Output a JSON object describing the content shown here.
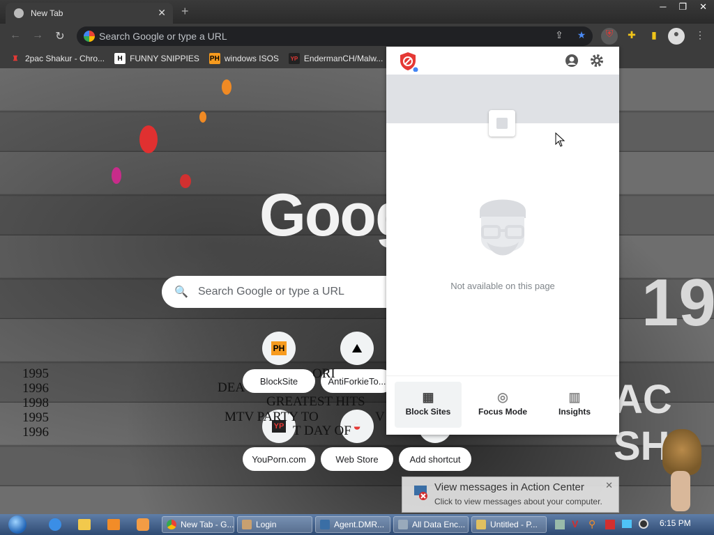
{
  "browser": {
    "tab_title": "New Tab",
    "tab_close": "✕",
    "new_tab": "+",
    "window_controls": [
      "─",
      "❐",
      "✕"
    ],
    "omnibox_placeholder": "Search Google or type a URL"
  },
  "bookmarks": [
    {
      "label": "2pac Shakur - Chro...",
      "icon": "tupac-icon",
      "icon_text": "♜",
      "color": "#e8e8e8"
    },
    {
      "label": "FUNNY SNIPPIES",
      "icon": "h-icon",
      "icon_text": "H",
      "color": "#fff"
    },
    {
      "label": "windows ISOS",
      "icon": "ph-icon",
      "icon_text": "PH",
      "color": "#f79b1e"
    },
    {
      "label": "EndermanCH/Malw...",
      "icon": "yp-icon",
      "icon_text": "YP",
      "color": "#fff"
    }
  ],
  "newtab": {
    "logo": "Goog",
    "search_placeholder": "Search Google or type a URL",
    "shortcuts": [
      {
        "label": "BlockSite",
        "icon_text": "PH"
      },
      {
        "label": "AntiForkieTo...",
        "icon_text": "⛰"
      },
      {
        "label": "YouPorn.com",
        "icon_text": "YP"
      },
      {
        "label": "Web Store",
        "icon_text": "◒"
      },
      {
        "label": "Add shortcut",
        "icon_text": "+"
      }
    ],
    "years": [
      "1995",
      "1996",
      "1998",
      "1995",
      "1996"
    ],
    "song_lines": [
      "ORI",
      "DEA",
      "GREATEST HITS",
      "MTV PARTY TO",
      "V",
      "T DAY OF"
    ],
    "bg_text_right": "AC SH",
    "bg_text_right2": "19"
  },
  "extension_popup": {
    "not_available": "Not available on this page",
    "footer": [
      {
        "label": "Block Sites",
        "icon": "block-sites-icon",
        "glyph": "▦"
      },
      {
        "label": "Focus Mode",
        "icon": "focus-mode-icon",
        "glyph": "◎"
      },
      {
        "label": "Insights",
        "icon": "insights-icon",
        "glyph": "▥"
      }
    ]
  },
  "notification": {
    "title": "View messages in Action Center",
    "body": "Click to view messages about your computer.",
    "close": "✕"
  },
  "taskbar": {
    "buttons": [
      {
        "label": "New Tab - G..."
      },
      {
        "label": "Login"
      },
      {
        "label": "Agent.DMR..."
      },
      {
        "label": "All Data Enc..."
      },
      {
        "label": "Untitled - P..."
      }
    ],
    "clock": "6:15 PM"
  },
  "colors": {
    "accent_blue": "#4285f4",
    "bookmark_star": "#4a8af4",
    "blocksite_red": "#e53935"
  }
}
